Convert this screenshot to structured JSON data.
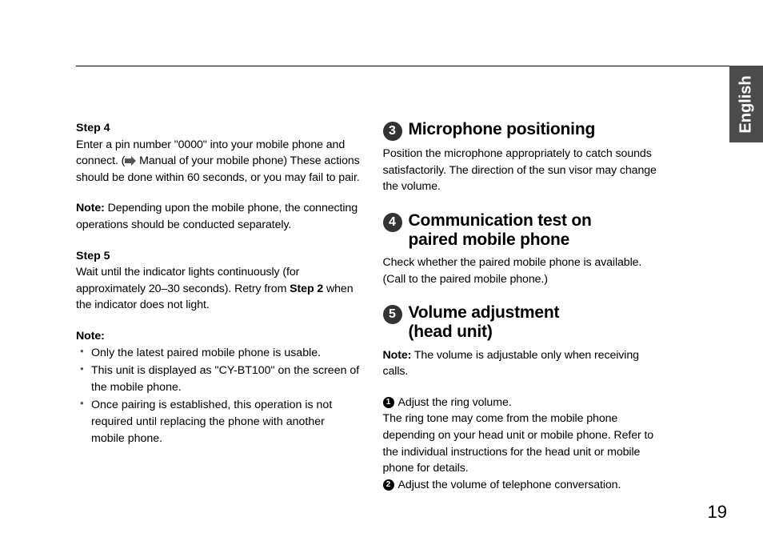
{
  "sideTab": "English",
  "pageNumber": "19",
  "left": {
    "step4": {
      "label": "Step 4",
      "line1a": "Enter a pin number \"0000\" into your mobile phone and connect. (",
      "line1b": " Manual of your mobile phone) These actions should be done within 60 seconds, or you may fail to pair."
    },
    "note1": {
      "label": "Note:",
      "text": " Depending upon the mobile phone, the connecting operations should be conducted separately."
    },
    "step5": {
      "label": "Step 5",
      "t1": "Wait until the indicator lights continuously (for approximately 20–30 seconds). Retry from ",
      "bold": "Step 2",
      "t2": " when the indicator does not light."
    },
    "note2": {
      "label": "Note:",
      "bullets": [
        "Only the latest paired mobile phone is usable.",
        "This unit is displayed as \"CY-BT100\" on the screen of the mobile phone.",
        "Once pairing is established, this operation is not required until replacing the phone with another mobile phone."
      ]
    }
  },
  "right": {
    "s3": {
      "num": "3",
      "title": "Microphone positioning",
      "body": "Position the microphone appropriately to catch sounds satisfactorily. The direction of the sun visor may change the volume."
    },
    "s4": {
      "num": "4",
      "titleA": "Communication test on",
      "titleB": "paired mobile phone",
      "body": "Check whether the paired mobile phone is available. (Call to the paired mobile phone.)"
    },
    "s5": {
      "num": "5",
      "titleA": "Volume adjustment",
      "titleB": "(head unit)",
      "noteLabel": "Note:",
      "noteText": " The volume is adjustable only when receiving calls.",
      "p1num": "1",
      "p1text": " Adjust the ring volume.",
      "p2": "The ring tone may come from the mobile phone depending on your head unit or mobile phone. Refer to the individual instructions for the head unit or mobile phone for details.",
      "p3num": "2",
      "p3text": " Adjust the volume of telephone conversation."
    }
  }
}
